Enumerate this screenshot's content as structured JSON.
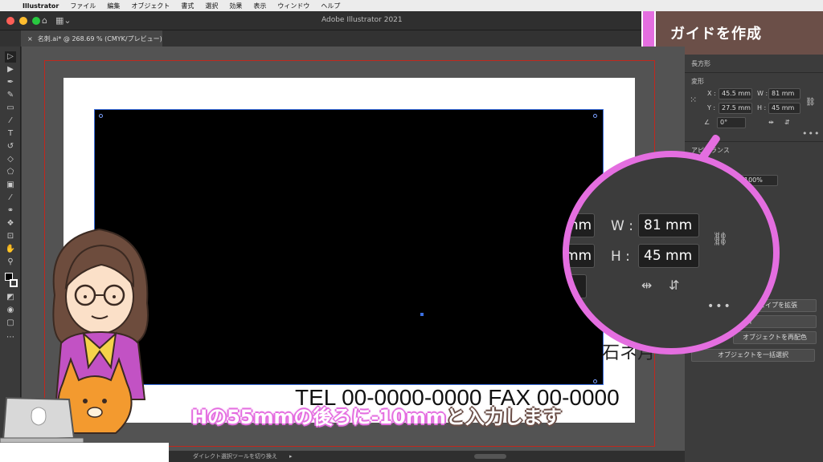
{
  "menubar": {
    "app": "Illustrator",
    "items": [
      "ファイル",
      "編集",
      "オブジェクト",
      "書式",
      "選択",
      "効果",
      "表示",
      "ウィンドウ",
      "ヘルプ"
    ]
  },
  "window": {
    "title": "Adobe Illustrator 2021",
    "doc_tab": "名刺.ai* @ 268.69 % (CMYK/プレビュー)",
    "close_glyph": "×"
  },
  "banner": {
    "title": "ガイドを作成",
    "colors": {
      "accent": "#e46ee0",
      "box": "#6b4f48"
    }
  },
  "panel": {
    "section_shape": "長方形",
    "section_transform": "変形",
    "x_label": "X :",
    "x_value": "45.5 mm",
    "y_label": "Y :",
    "y_value": "27.5 mm",
    "w_label": "W :",
    "w_value": "81 mm",
    "h_label": "H :",
    "h_value": "45 mm",
    "angle_value": "0°",
    "appearance_label": "アピアランス",
    "opacity_value": "100%",
    "btn_expand_shape": "シェイプを拡張",
    "btn_stack": "ね順",
    "btn_recolor": "オブジェクトを再配色",
    "btn_select_all": "オブジェクトを一括選択",
    "more": "•••"
  },
  "zoom": {
    "w_label": "W :",
    "w_value": "81 mm",
    "h_label": "H :",
    "h_value": "45 mm",
    "left_partial_1": "mm",
    "left_partial_2": "mm",
    "more": "•••"
  },
  "canvas": {
    "card_text_company": "石ネ月",
    "card_text_contact": "TEL 00-0000-0000   FAX 00-0000"
  },
  "status": {
    "tool_hint": "ダイレクト選択ツールを切り換え"
  },
  "caption": {
    "part_pink": "Hの55mmの後ろに-10mm",
    "part_white": "と入力します"
  }
}
